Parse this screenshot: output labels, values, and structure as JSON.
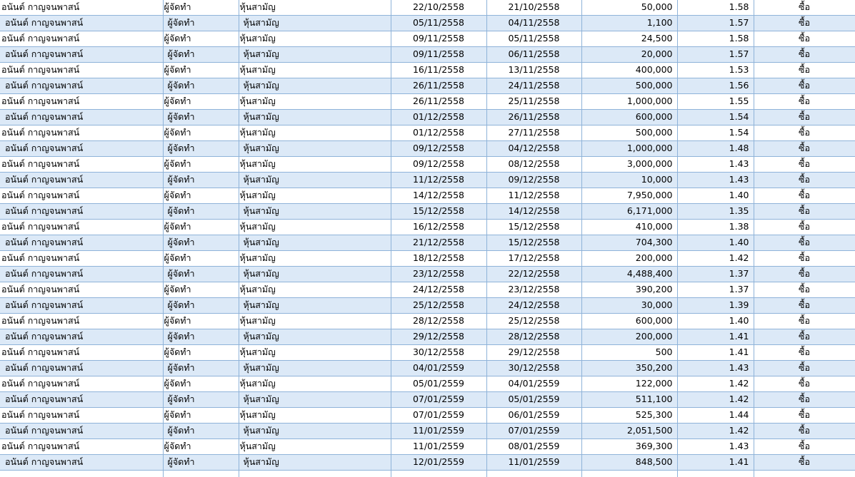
{
  "rows": [
    {
      "name": "อนันต์ กาญจนพาสน์",
      "position": "ผู้จัดทำ",
      "security": "หุ้นสามัญ",
      "report_date": "22/10/2558",
      "trade_date": "21/10/2558",
      "volume": "50,000",
      "price": "1.58",
      "type": "ซื้อ"
    },
    {
      "name": "อนันต์ กาญจนพาสน์",
      "position": "ผู้จัดทำ",
      "security": "หุ้นสามัญ",
      "report_date": "05/11/2558",
      "trade_date": "04/11/2558",
      "volume": "1,100",
      "price": "1.57",
      "type": "ซื้อ"
    },
    {
      "name": "อนันต์ กาญจนพาสน์",
      "position": "ผู้จัดทำ",
      "security": "หุ้นสามัญ",
      "report_date": "09/11/2558",
      "trade_date": "05/11/2558",
      "volume": "24,500",
      "price": "1.58",
      "type": "ซื้อ"
    },
    {
      "name": "อนันต์ กาญจนพาสน์",
      "position": "ผู้จัดทำ",
      "security": "หุ้นสามัญ",
      "report_date": "09/11/2558",
      "trade_date": "06/11/2558",
      "volume": "20,000",
      "price": "1.57",
      "type": "ซื้อ"
    },
    {
      "name": "อนันต์ กาญจนพาสน์",
      "position": "ผู้จัดทำ",
      "security": "หุ้นสามัญ",
      "report_date": "16/11/2558",
      "trade_date": "13/11/2558",
      "volume": "400,000",
      "price": "1.53",
      "type": "ซื้อ"
    },
    {
      "name": "อนันต์ กาญจนพาสน์",
      "position": "ผู้จัดทำ",
      "security": "หุ้นสามัญ",
      "report_date": "26/11/2558",
      "trade_date": "24/11/2558",
      "volume": "500,000",
      "price": "1.56",
      "type": "ซื้อ"
    },
    {
      "name": "อนันต์ กาญจนพาสน์",
      "position": "ผู้จัดทำ",
      "security": "หุ้นสามัญ",
      "report_date": "26/11/2558",
      "trade_date": "25/11/2558",
      "volume": "1,000,000",
      "price": "1.55",
      "type": "ซื้อ"
    },
    {
      "name": "อนันต์ กาญจนพาสน์",
      "position": "ผู้จัดทำ",
      "security": "หุ้นสามัญ",
      "report_date": "01/12/2558",
      "trade_date": "26/11/2558",
      "volume": "600,000",
      "price": "1.54",
      "type": "ซื้อ"
    },
    {
      "name": "อนันต์ กาญจนพาสน์",
      "position": "ผู้จัดทำ",
      "security": "หุ้นสามัญ",
      "report_date": "01/12/2558",
      "trade_date": "27/11/2558",
      "volume": "500,000",
      "price": "1.54",
      "type": "ซื้อ"
    },
    {
      "name": "อนันต์ กาญจนพาสน์",
      "position": "ผู้จัดทำ",
      "security": "หุ้นสามัญ",
      "report_date": "09/12/2558",
      "trade_date": "04/12/2558",
      "volume": "1,000,000",
      "price": "1.48",
      "type": "ซื้อ"
    },
    {
      "name": "อนันต์ กาญจนพาสน์",
      "position": "ผู้จัดทำ",
      "security": "หุ้นสามัญ",
      "report_date": "09/12/2558",
      "trade_date": "08/12/2558",
      "volume": "3,000,000",
      "price": "1.43",
      "type": "ซื้อ"
    },
    {
      "name": "อนันต์ กาญจนพาสน์",
      "position": "ผู้จัดทำ",
      "security": "หุ้นสามัญ",
      "report_date": "11/12/2558",
      "trade_date": "09/12/2558",
      "volume": "10,000",
      "price": "1.43",
      "type": "ซื้อ"
    },
    {
      "name": "อนันต์ กาญจนพาสน์",
      "position": "ผู้จัดทำ",
      "security": "หุ้นสามัญ",
      "report_date": "14/12/2558",
      "trade_date": "11/12/2558",
      "volume": "7,950,000",
      "price": "1.40",
      "type": "ซื้อ"
    },
    {
      "name": "อนันต์ กาญจนพาสน์",
      "position": "ผู้จัดทำ",
      "security": "หุ้นสามัญ",
      "report_date": "15/12/2558",
      "trade_date": "14/12/2558",
      "volume": "6,171,000",
      "price": "1.35",
      "type": "ซื้อ"
    },
    {
      "name": "อนันต์ กาญจนพาสน์",
      "position": "ผู้จัดทำ",
      "security": "หุ้นสามัญ",
      "report_date": "16/12/2558",
      "trade_date": "15/12/2558",
      "volume": "410,000",
      "price": "1.38",
      "type": "ซื้อ"
    },
    {
      "name": "อนันต์ กาญจนพาสน์",
      "position": "ผู้จัดทำ",
      "security": "หุ้นสามัญ",
      "report_date": "21/12/2558",
      "trade_date": "15/12/2558",
      "volume": "704,300",
      "price": "1.40",
      "type": "ซื้อ"
    },
    {
      "name": "อนันต์ กาญจนพาสน์",
      "position": "ผู้จัดทำ",
      "security": "หุ้นสามัญ",
      "report_date": "18/12/2558",
      "trade_date": "17/12/2558",
      "volume": "200,000",
      "price": "1.42",
      "type": "ซื้อ"
    },
    {
      "name": "อนันต์ กาญจนพาสน์",
      "position": "ผู้จัดทำ",
      "security": "หุ้นสามัญ",
      "report_date": "23/12/2558",
      "trade_date": "22/12/2558",
      "volume": "4,488,400",
      "price": "1.37",
      "type": "ซื้อ"
    },
    {
      "name": "อนันต์ กาญจนพาสน์",
      "position": "ผู้จัดทำ",
      "security": "หุ้นสามัญ",
      "report_date": "24/12/2558",
      "trade_date": "23/12/2558",
      "volume": "390,200",
      "price": "1.37",
      "type": "ซื้อ"
    },
    {
      "name": "อนันต์ กาญจนพาสน์",
      "position": "ผู้จัดทำ",
      "security": "หุ้นสามัญ",
      "report_date": "25/12/2558",
      "trade_date": "24/12/2558",
      "volume": "30,000",
      "price": "1.39",
      "type": "ซื้อ"
    },
    {
      "name": "อนันต์ กาญจนพาสน์",
      "position": "ผู้จัดทำ",
      "security": "หุ้นสามัญ",
      "report_date": "28/12/2558",
      "trade_date": "25/12/2558",
      "volume": "600,000",
      "price": "1.40",
      "type": "ซื้อ"
    },
    {
      "name": "อนันต์ กาญจนพาสน์",
      "position": "ผู้จัดทำ",
      "security": "หุ้นสามัญ",
      "report_date": "29/12/2558",
      "trade_date": "28/12/2558",
      "volume": "200,000",
      "price": "1.41",
      "type": "ซื้อ"
    },
    {
      "name": "อนันต์ กาญจนพาสน์",
      "position": "ผู้จัดทำ",
      "security": "หุ้นสามัญ",
      "report_date": "30/12/2558",
      "trade_date": "29/12/2558",
      "volume": "500",
      "price": "1.41",
      "type": "ซื้อ"
    },
    {
      "name": "อนันต์ กาญจนพาสน์",
      "position": "ผู้จัดทำ",
      "security": "หุ้นสามัญ",
      "report_date": "04/01/2559",
      "trade_date": "30/12/2558",
      "volume": "350,200",
      "price": "1.43",
      "type": "ซื้อ"
    },
    {
      "name": "อนันต์ กาญจนพาสน์",
      "position": "ผู้จัดทำ",
      "security": "หุ้นสามัญ",
      "report_date": "05/01/2559",
      "trade_date": "04/01/2559",
      "volume": "122,000",
      "price": "1.42",
      "type": "ซื้อ"
    },
    {
      "name": "อนันต์ กาญจนพาสน์",
      "position": "ผู้จัดทำ",
      "security": "หุ้นสามัญ",
      "report_date": "07/01/2559",
      "trade_date": "05/01/2559",
      "volume": "511,100",
      "price": "1.42",
      "type": "ซื้อ"
    },
    {
      "name": "อนันต์ กาญจนพาสน์",
      "position": "ผู้จัดทำ",
      "security": "หุ้นสามัญ",
      "report_date": "07/01/2559",
      "trade_date": "06/01/2559",
      "volume": "525,300",
      "price": "1.44",
      "type": "ซื้อ"
    },
    {
      "name": "อนันต์ กาญจนพาสน์",
      "position": "ผู้จัดทำ",
      "security": "หุ้นสามัญ",
      "report_date": "11/01/2559",
      "trade_date": "07/01/2559",
      "volume": "2,051,500",
      "price": "1.42",
      "type": "ซื้อ"
    },
    {
      "name": "อนันต์ กาญจนพาสน์",
      "position": "ผู้จัดทำ",
      "security": "หุ้นสามัญ",
      "report_date": "11/01/2559",
      "trade_date": "08/01/2559",
      "volume": "369,300",
      "price": "1.43",
      "type": "ซื้อ"
    },
    {
      "name": "อนันต์ กาญจนพาสน์",
      "position": "ผู้จัดทำ",
      "security": "หุ้นสามัญ",
      "report_date": "12/01/2559",
      "trade_date": "11/01/2559",
      "volume": "848,500",
      "price": "1.41",
      "type": "ซื้อ"
    }
  ]
}
